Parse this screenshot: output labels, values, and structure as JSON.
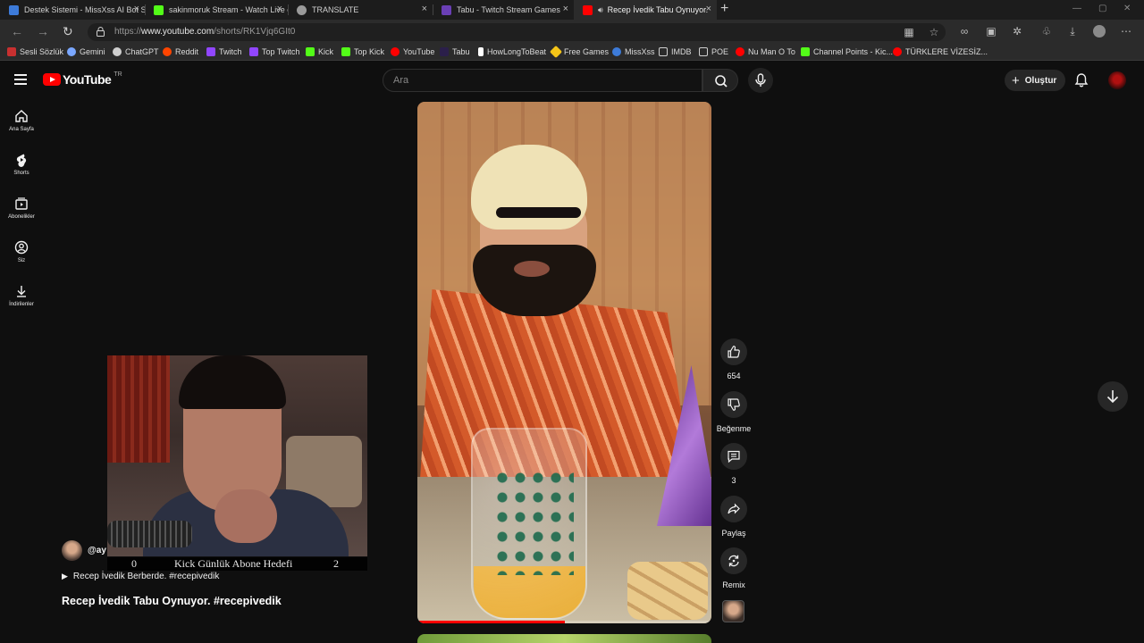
{
  "browser": {
    "tabs": [
      {
        "title": "Destek Sistemi - MissXss AI Bot S",
        "color": "#3d7bd9"
      },
      {
        "title": "sakinmoruk Stream - Watch Live o",
        "color": "#53fc18"
      },
      {
        "title": "TRANSLATE",
        "color": "#9a9a9a"
      },
      {
        "title": "Tabu - Twitch Stream Games",
        "color": "#6a3fb5"
      },
      {
        "title": "Recep İvedik Tabu Oynuyor.",
        "color": "#ff0000"
      }
    ],
    "url_prefix": "https://",
    "url_host": "www.youtube.com",
    "url_path": "/shorts/RK1Vjq6GIt0",
    "bookmarks": [
      {
        "label": "Sesli Sözlük",
        "color": "#c83030"
      },
      {
        "label": "Gemini",
        "color": "#7aa7ff"
      },
      {
        "label": "ChatGPT",
        "color": "#cfcfcf"
      },
      {
        "label": "Reddit",
        "color": "#ff4500"
      },
      {
        "label": "Twitch",
        "color": "#9146ff"
      },
      {
        "label": "Top Twitch",
        "color": "#9146ff"
      },
      {
        "label": "Kick",
        "color": "#53fc18"
      },
      {
        "label": "Top Kick",
        "color": "#53fc18"
      },
      {
        "label": "YouTube",
        "color": "#ff0000"
      },
      {
        "label": "Tabu",
        "color": "#6a3fb5"
      },
      {
        "label": "HowLongToBeat",
        "color": "#ffffff"
      },
      {
        "label": "Free Games",
        "color": "#f5c518"
      },
      {
        "label": "MissXss",
        "color": "#3d7bd9"
      },
      {
        "label": "IMDB",
        "color": "#9a9a9a"
      },
      {
        "label": "POE",
        "color": "#9a9a9a"
      },
      {
        "label": "Nu Man O To",
        "color": "#ff0000"
      },
      {
        "label": "Channel Points - Kic...",
        "color": "#53fc18"
      },
      {
        "label": "TÜRKLERE VİZESİZ...",
        "color": "#ff0000"
      }
    ]
  },
  "youtube": {
    "logo": "YouTube",
    "country": "TR",
    "search_placeholder": "Ara",
    "create_label": "Oluştur",
    "sidebar": [
      {
        "label": "Ana Sayfa",
        "icon": "home-icon"
      },
      {
        "label": "Shorts",
        "icon": "shorts-icon"
      },
      {
        "label": "Abonelikler",
        "icon": "subscriptions-icon"
      },
      {
        "label": "Siz",
        "icon": "you-icon"
      },
      {
        "label": "İndirilenler",
        "icon": "downloads-icon"
      }
    ],
    "actions": {
      "likes": "654",
      "dislike_label": "Beğenme",
      "comments": "3",
      "share_label": "Paylaş",
      "remix_label": "Remix"
    },
    "progress_fraction": 0.5,
    "channel_handle": "@ay",
    "description": "Recep İvedik Berberde. #recepivedik",
    "title": "Recep İvedik Tabu Oynuyor. #recepivedik"
  },
  "overlay": {
    "goal_current": "0",
    "goal_text": "Kick Günlük Abone Hedefi",
    "goal_target": "2"
  }
}
